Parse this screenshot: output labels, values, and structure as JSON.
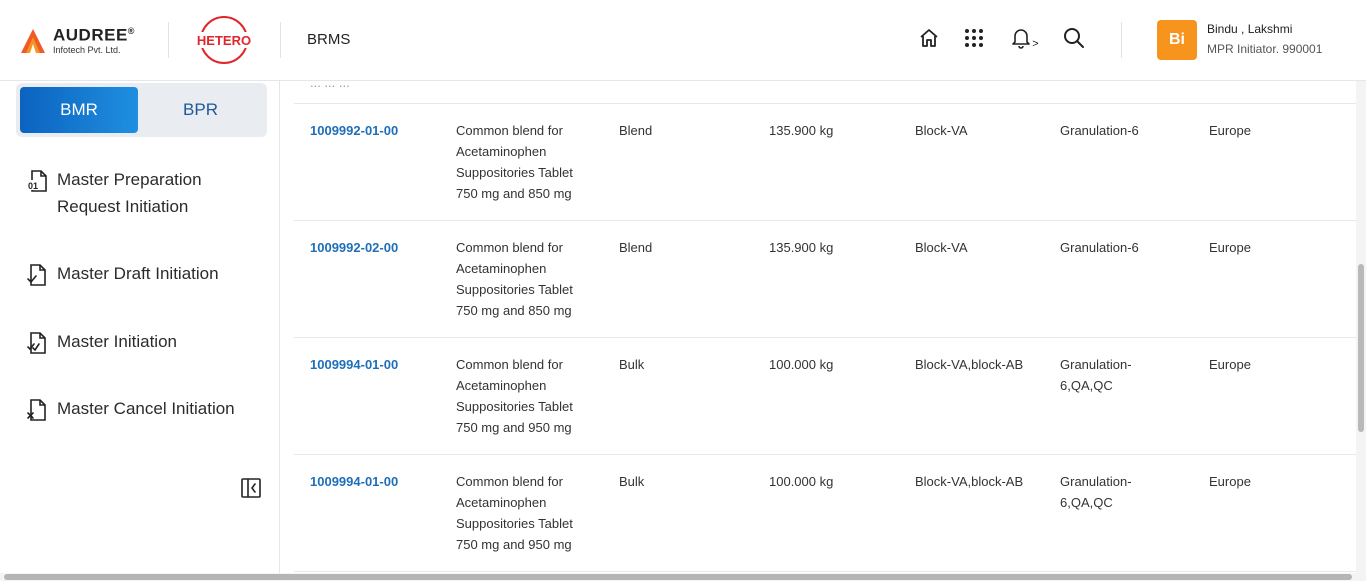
{
  "header": {
    "brand_name": "AUDREE",
    "brand_mark": "®",
    "brand_sub": "Infotech Pvt. Ltd.",
    "partner_logo": "HETERO",
    "app_name": "BRMS",
    "icons": [
      "home-icon",
      "apps-grid-icon",
      "bell-icon",
      "search-icon"
    ],
    "notification_chevron": ">",
    "user": {
      "initials": "Bi",
      "name": "Bindu , Lakshmi",
      "role": "MPR Initiator. 990001"
    },
    "colors": {
      "accent": "#f7941e",
      "hetero_red": "#e0262b"
    }
  },
  "sidebar": {
    "tabs": [
      {
        "label": "BMR",
        "active": true
      },
      {
        "label": "BPR",
        "active": false
      }
    ],
    "items": [
      {
        "label_line1": "Master Preparation",
        "label_line2": "Request Initiation",
        "icon": "document-01-icon"
      },
      {
        "label": "Master Draft Initiation",
        "icon": "document-check-icon"
      },
      {
        "label": "Master Initiation",
        "icon": "document-double-check-icon"
      },
      {
        "label": "Master Cancel Initiation",
        "icon": "document-cancel-icon"
      }
    ]
  },
  "table": {
    "partial_row_text": "... ... ...",
    "rows": [
      {
        "code": "1009992-01-00",
        "desc": [
          "Common blend for",
          "Acetaminophen",
          "Suppositories Tablet",
          "750 mg and 850 mg"
        ],
        "type": "Blend",
        "qty": "135.900 kg",
        "block": "Block-VA",
        "area": [
          "Granulation-6"
        ],
        "market": "Europe"
      },
      {
        "code": "1009992-02-00",
        "desc": [
          "Common blend for",
          "Acetaminophen",
          "Suppositories Tablet",
          "750 mg and 850 mg"
        ],
        "type": "Blend",
        "qty": "135.900 kg",
        "block": "Block-VA",
        "area": [
          "Granulation-6"
        ],
        "market": "Europe"
      },
      {
        "code": "1009994-01-00",
        "desc": [
          "Common blend for",
          "Acetaminophen",
          "Suppositories Tablet",
          "750 mg and 950 mg"
        ],
        "type": "Bulk",
        "qty": "100.000 kg",
        "block": "Block-VA,block-AB",
        "area": [
          "Granulation-",
          "6,QA,QC"
        ],
        "market": "Europe"
      },
      {
        "code": "1009994-01-00",
        "desc": [
          "Common blend for",
          "Acetaminophen",
          "Suppositories Tablet",
          "750 mg and 950 mg"
        ],
        "type": "Bulk",
        "qty": "100.000 kg",
        "block": "Block-VA,block-AB",
        "area": [
          "Granulation-",
          "6,QA,QC"
        ],
        "market": "Europe"
      }
    ]
  }
}
